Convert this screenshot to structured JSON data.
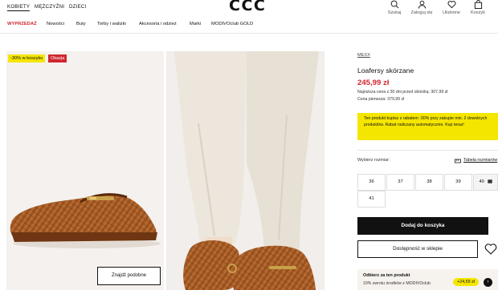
{
  "header": {
    "gender_tabs": [
      "KOBIETY",
      "MĘŻCZYŹNI",
      "DZIECI"
    ],
    "logo": "CCC",
    "icons": [
      {
        "label": "Szukaj",
        "icon": "search-icon"
      },
      {
        "label": "Zaloguj się",
        "icon": "user-icon"
      },
      {
        "label": "Ulubione",
        "icon": "heart-icon"
      },
      {
        "label": "Koszyk",
        "icon": "bag-icon"
      }
    ]
  },
  "nav": {
    "items": [
      "WYPRZEDAŻ",
      "Nowości",
      "Buty",
      "Torby i walizki",
      "Akcesoria i odzież",
      "Marki",
      "MODIVOclub GOLD"
    ],
    "sale_color": "#d0262f"
  },
  "gallery": {
    "badges": [
      "-30% w koszyku",
      "Okazja"
    ],
    "similar_button": "Znajdź podobne"
  },
  "product": {
    "brand": "MEXX",
    "name": "Loafersy skórzane",
    "price": "245,99 zł",
    "lowest_price_note": "Najniższa cena z 30 dni przed obniżką: 307,99 zł",
    "first_price_note": "Cena pierwsza: 379,99 zł",
    "promo": "Ten produkt kupisz z rabatem -30% przy zakupie min. 2 dowolnych produktów. Rabat naliczany automatycznie. Kup teraz!",
    "promo_color": "#f5e600"
  },
  "sizes": {
    "label": "Wybierz rozmiar:",
    "table_link": "Tabela rozmiarów",
    "options": [
      "36",
      "37",
      "38",
      "39",
      "40",
      "41"
    ],
    "low_stock_size": "40"
  },
  "actions": {
    "add_to_cart": "Dodaj do koszyka",
    "in_store": "Dostępność w sklepie"
  },
  "modivo": {
    "title": "Odbierz za ten produkt",
    "text": "10% zwrotu środków z MODIVOclub",
    "reward": "+24,59 zł"
  }
}
